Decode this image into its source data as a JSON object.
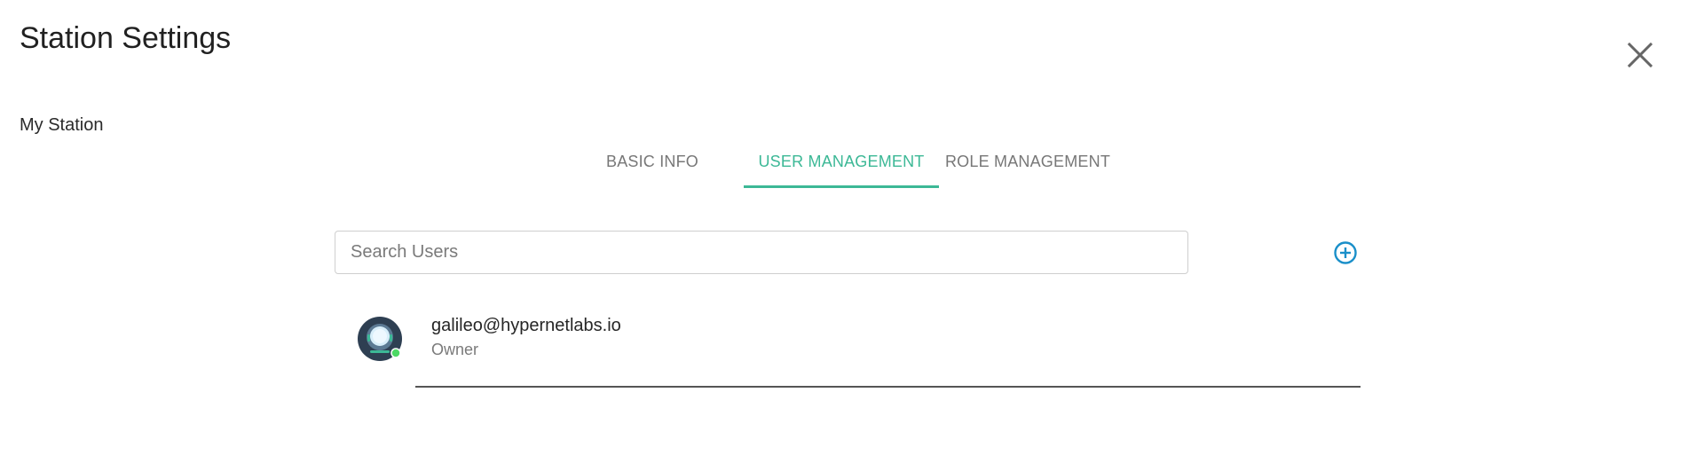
{
  "header": {
    "title": "Station Settings",
    "station_name": "My Station"
  },
  "tabs": [
    {
      "label": "BASIC INFO",
      "active": false
    },
    {
      "label": "USER MANAGEMENT",
      "active": true
    },
    {
      "label": "ROLE MANAGEMENT",
      "active": false
    }
  ],
  "search": {
    "placeholder": "Search Users",
    "value": ""
  },
  "users": [
    {
      "email": "galileo@hypernetlabs.io",
      "role": "Owner",
      "avatar_icon": "user-avatar-icon",
      "online": true
    }
  ],
  "colors": {
    "accent": "#3cb896",
    "add_icon": "#1a8fc9",
    "tab_inactive": "#777777",
    "close_icon": "#666666"
  },
  "icons": {
    "close": "close-icon",
    "add": "add-circle-icon"
  }
}
